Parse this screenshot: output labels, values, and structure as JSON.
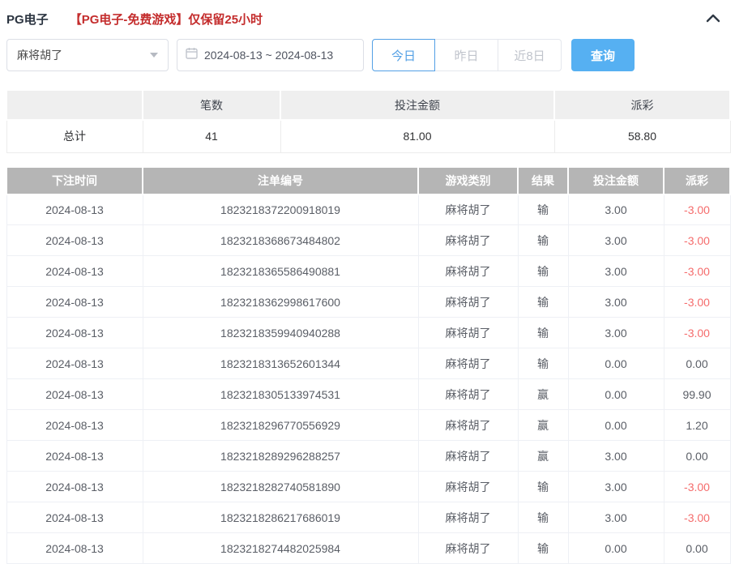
{
  "header": {
    "title": "PG电子",
    "notice": "【PG电子-免费游戏】仅保留25小时"
  },
  "filters": {
    "game_select": {
      "value": "麻将胡了"
    },
    "date_range": {
      "value": "2024-08-13 ~ 2024-08-13"
    },
    "quick_buttons": [
      {
        "label": "今日",
        "active": true
      },
      {
        "label": "昨日",
        "active": false
      },
      {
        "label": "近8日",
        "active": false
      }
    ],
    "query_label": "查询"
  },
  "colors": {
    "accent_blue": "#56b0f2",
    "active_tab_blue": "#53a0e5",
    "danger_red": "#f56c6c",
    "notice_red": "#c42d2d",
    "records_header_gray": "#b5b5b5"
  },
  "icons": {
    "collapse": "chevron-up-icon",
    "select_caret": "chevron-down-icon",
    "date": "calendar-icon"
  },
  "summary": {
    "columns": [
      "",
      "笔数",
      "投注金额",
      "派彩"
    ],
    "row": {
      "label": "总计",
      "values": [
        "41",
        "81.00",
        "58.80"
      ]
    }
  },
  "records": {
    "columns": [
      "下注时间",
      "注单编号",
      "游戏类别",
      "结果",
      "投注金额",
      "派彩"
    ],
    "rows": [
      [
        "2024-08-13",
        "1823218372200918019",
        "麻将胡了",
        "输",
        "3.00",
        "-3.00"
      ],
      [
        "2024-08-13",
        "1823218368673484802",
        "麻将胡了",
        "输",
        "3.00",
        "-3.00"
      ],
      [
        "2024-08-13",
        "1823218365586490881",
        "麻将胡了",
        "输",
        "3.00",
        "-3.00"
      ],
      [
        "2024-08-13",
        "1823218362998617600",
        "麻将胡了",
        "输",
        "3.00",
        "-3.00"
      ],
      [
        "2024-08-13",
        "1823218359940940288",
        "麻将胡了",
        "输",
        "3.00",
        "-3.00"
      ],
      [
        "2024-08-13",
        "1823218313652601344",
        "麻将胡了",
        "输",
        "0.00",
        "0.00"
      ],
      [
        "2024-08-13",
        "1823218305133974531",
        "麻将胡了",
        "赢",
        "0.00",
        "99.90"
      ],
      [
        "2024-08-13",
        "1823218296770556929",
        "麻将胡了",
        "赢",
        "0.00",
        "1.20"
      ],
      [
        "2024-08-13",
        "1823218289296288257",
        "麻将胡了",
        "赢",
        "3.00",
        "0.00"
      ],
      [
        "2024-08-13",
        "1823218282740581890",
        "麻将胡了",
        "输",
        "3.00",
        "-3.00"
      ],
      [
        "2024-08-13",
        "1823218286217686019",
        "麻将胡了",
        "输",
        "3.00",
        "-3.00"
      ],
      [
        "2024-08-13",
        "1823218274482025984",
        "麻将胡了",
        "输",
        "0.00",
        "0.00"
      ]
    ]
  }
}
